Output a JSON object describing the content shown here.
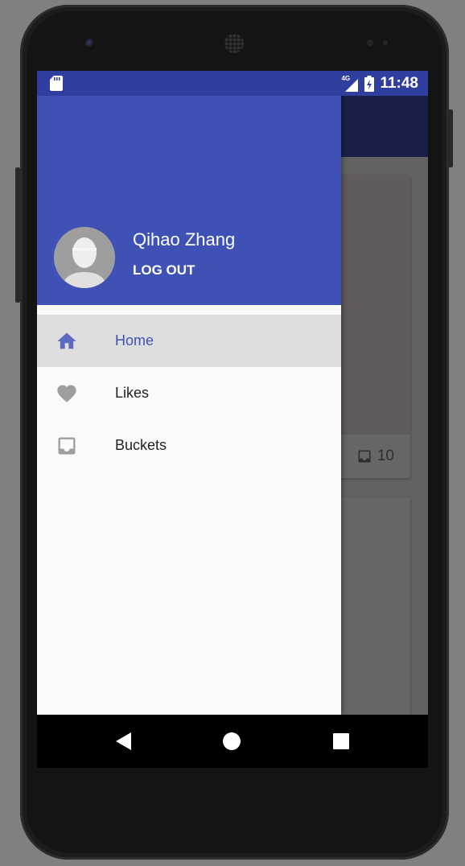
{
  "status_bar": {
    "network": "4G",
    "time": "11:48",
    "icons": [
      "sd-card-icon",
      "signal-icon",
      "battery-charging-icon"
    ]
  },
  "drawer": {
    "user_name": "Qihao Zhang",
    "logout_label": "LOG OUT",
    "items": [
      {
        "label": "Home",
        "icon": "home-icon",
        "active": true
      },
      {
        "label": "Likes",
        "icon": "heart-icon",
        "active": false
      },
      {
        "label": "Buckets",
        "icon": "inbox-icon",
        "active": false
      }
    ]
  },
  "background_card": {
    "bucket_count": "10",
    "icon": "inbox-icon"
  },
  "nav_bar": {
    "buttons": [
      "back-button",
      "home-button",
      "recents-button"
    ]
  },
  "colors": {
    "primary": "#3f51b5",
    "primary_dark": "#303f9f",
    "active_item_bg": "#dedede",
    "icon_gray": "#9e9e9e"
  }
}
